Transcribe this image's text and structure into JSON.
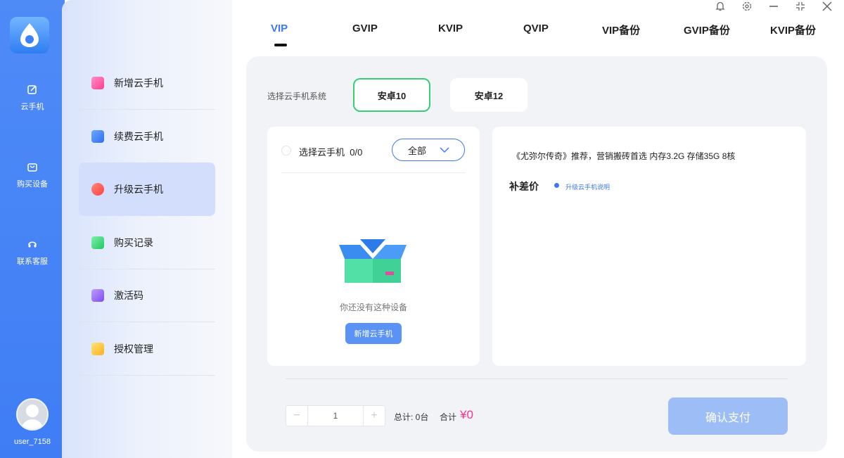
{
  "rail": {
    "items": [
      {
        "label": "云手机",
        "icon": "edit-icon"
      },
      {
        "label": "购买设备",
        "icon": "bag-icon"
      },
      {
        "label": "联系客服",
        "icon": "headset-icon"
      }
    ],
    "user": "user_7158"
  },
  "menu": {
    "items": [
      {
        "label": "新增云手机",
        "icon": "add-phone-icon",
        "color": "#ff4fa0"
      },
      {
        "label": "续费云手机",
        "icon": "renew-icon",
        "color": "#3b7ff5"
      },
      {
        "label": "升级云手机",
        "icon": "upgrade-icon",
        "color": "#ff5a4a"
      },
      {
        "label": "购买记录",
        "icon": "record-icon",
        "color": "#3dd77c"
      },
      {
        "label": "激活码",
        "icon": "code-icon",
        "color": "#9a6cf2"
      },
      {
        "label": "授权管理",
        "icon": "auth-icon",
        "color": "#ffc531"
      }
    ],
    "active_index": 2
  },
  "tabs": [
    "VIP",
    "GVIP",
    "KVIP",
    "QVIP",
    "VIP备份",
    "GVIP备份",
    "KVIP备份"
  ],
  "active_tab": "VIP",
  "system": {
    "label": "选择云手机系统",
    "options": [
      "安卓10",
      "安卓12"
    ],
    "selected": "安卓10"
  },
  "device_select": {
    "label": "选择云手机",
    "count": "0/0",
    "filter": "全部",
    "empty_text": "你还没有这种设备",
    "add_button": "新增云手机"
  },
  "info": {
    "description": "《尤弥尔传奇》推荐，营销搬砖首选 内存3.2G 存储35G 8核",
    "diff_label": "补差价",
    "upgrade_link": "升级云手机说明"
  },
  "footer": {
    "quantity": "1",
    "total": "总计: 0台",
    "sum_label": "合计",
    "price": "¥0",
    "confirm": "确认支付"
  },
  "colors": {
    "accent": "#3e78f0",
    "selected_border": "#36cf74",
    "price": "#ff2f8c",
    "rail": "#4f8bf7"
  }
}
